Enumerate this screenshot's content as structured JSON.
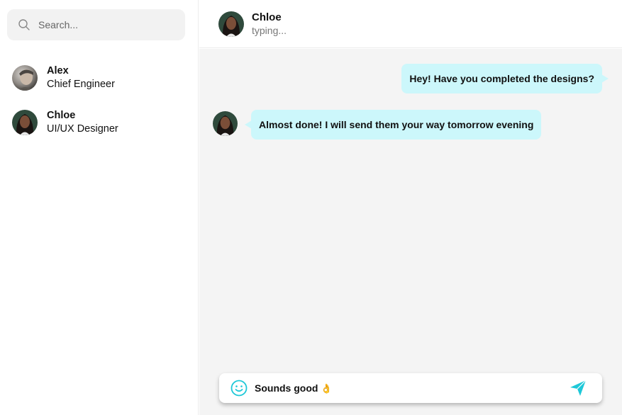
{
  "search": {
    "placeholder": "Search..."
  },
  "contacts": [
    {
      "name": "Alex",
      "role": "Chief Engineer",
      "avatar": "alex-avatar"
    },
    {
      "name": "Chloe",
      "role": "UI/UX Designer",
      "avatar": "chloe-avatar"
    }
  ],
  "header": {
    "name": "Chloe",
    "status": "typing..."
  },
  "messages": [
    {
      "direction": "outgoing",
      "text": "Hey! Have you completed the designs?"
    },
    {
      "direction": "incoming",
      "text": "Almost done! I will send them your way tomorrow evening",
      "avatar": "chloe-avatar"
    }
  ],
  "composer": {
    "value": "Sounds good",
    "emoji": "👌"
  },
  "colors": {
    "accent": "#1ec8d8",
    "bubble": "#ccf7fb",
    "chat_bg": "#f4f4f4"
  },
  "icons": {
    "search": "search-icon",
    "emoji": "smiley-icon",
    "send": "send-icon"
  }
}
